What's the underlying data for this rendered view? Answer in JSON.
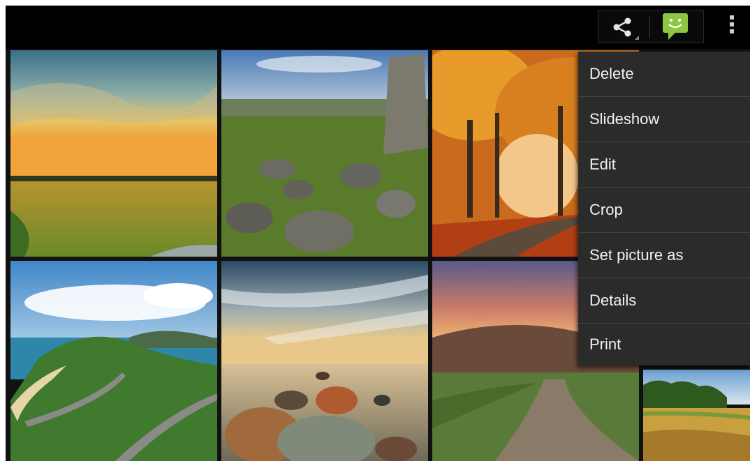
{
  "action_bar": {
    "share_icon": "share-icon",
    "messaging_icon": "messaging-icon",
    "overflow_icon": "overflow-menu-icon",
    "messaging_color": "#8ec641"
  },
  "gallery": {
    "photos": [
      {
        "name": "photo-meadow-sunset",
        "subject": "meadow at sunset"
      },
      {
        "name": "photo-rocky-moor",
        "subject": "rocky moorland"
      },
      {
        "name": "photo-autumn-forest-road",
        "subject": "autumn forest road"
      },
      {
        "name": "photo-coastal-road",
        "subject": "coastal road and hills"
      },
      {
        "name": "photo-rocks-water",
        "subject": "rocks in water under dramatic sky"
      },
      {
        "name": "photo-hill-path-sunset",
        "subject": "hill path at sunset"
      },
      {
        "name": "photo-field-trees",
        "subject": "field with trees"
      }
    ]
  },
  "overflow_menu": {
    "items": [
      "Delete",
      "Slideshow",
      "Edit",
      "Crop",
      "Set picture as",
      "Details",
      "Print"
    ]
  }
}
